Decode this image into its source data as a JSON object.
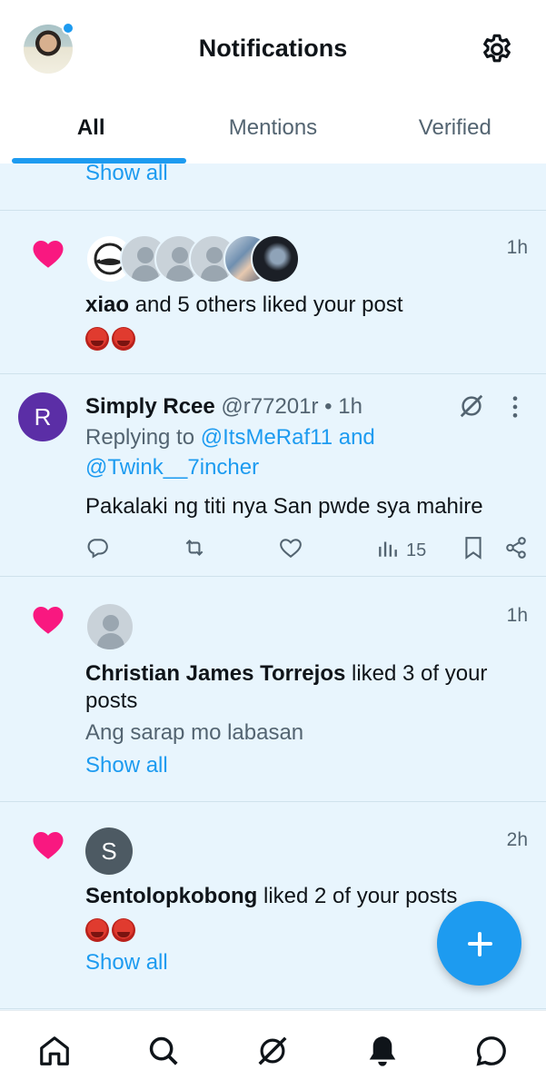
{
  "header": {
    "title": "Notifications",
    "avatar_icon": "profile-avatar",
    "settings_icon": "gear-icon"
  },
  "tabs": [
    {
      "label": "All",
      "active": true
    },
    {
      "label": "Mentions",
      "active": false
    },
    {
      "label": "Verified",
      "active": false
    }
  ],
  "feed": {
    "top_show_all": "Show all",
    "item1": {
      "user": "xiao",
      "text": " and 5 others liked your post",
      "time": "1h",
      "emoji_count": 2
    },
    "reply": {
      "avatar_letter": "R",
      "name": "Simply Rcee",
      "handle": "@r77201r",
      "sep": " • ",
      "time": "1h",
      "replying_prefix": "Replying to ",
      "replying_to_1": "@ItsMeRaf11 and",
      "replying_to_2": "@Twink__7incher",
      "body": "Pakalaki ng titi nya San pwde sya mahire",
      "views": "15"
    },
    "item3": {
      "user": "Christian James Torrejos",
      "text_line1": " liked 3 of your",
      "text_line2": "posts",
      "quote": "Ang sarap mo labasan",
      "show_all": "Show all",
      "time": "1h"
    },
    "item4": {
      "avatar_letter": "S",
      "user": "Sentolopkobong",
      "text": " liked 2 of your posts",
      "show_all": "Show all",
      "time": "2h",
      "emoji_count": 2
    }
  },
  "colors": {
    "accent": "#1d9bf0",
    "like": "#f91880",
    "feed_bg": "#e8f5fd"
  },
  "bottom_nav": [
    "home-icon",
    "search-icon",
    "grok-icon",
    "notifications-icon",
    "messages-icon"
  ]
}
